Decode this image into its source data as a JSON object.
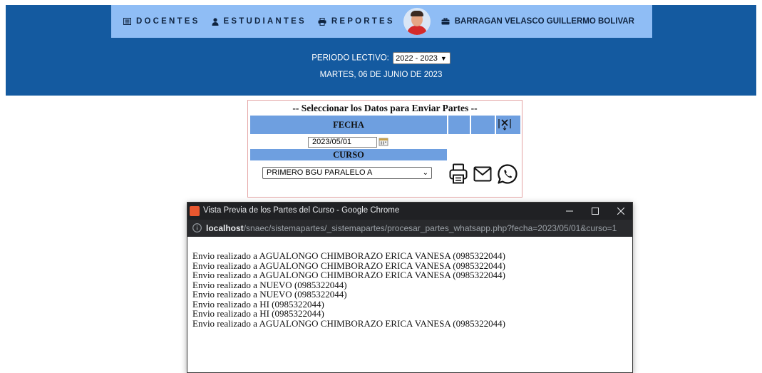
{
  "nav": {
    "docentes": "DOCENTES",
    "estudiantes": "ESTUDIANTES",
    "reportes": "REPORTES",
    "user_name": "BARRAGAN VELASCO GUILLERMO BOLIVAR"
  },
  "period": {
    "label": "PERIODO LECTIVO:",
    "selected": "2022 - 2023",
    "date_text": "MARTES, 06 DE JUNIO DE 2023"
  },
  "form": {
    "title": "-- Seleccionar los Datos para Enviar Partes --",
    "fecha_label": "FECHA",
    "fecha_value": "2023/05/01",
    "curso_label": "CURSO",
    "curso_selected": "PRIMERO BGU PARALELO A"
  },
  "popup": {
    "title": "Vista Previa de los Partes del Curso - Google Chrome",
    "url_host": "localhost",
    "url_path": "/snaec/sistemapartes/_sistemapartes/procesar_partes_whatsapp.php?fecha=2023/05/01&curso=1",
    "lines": [
      "Envio realizado a AGUALONGO CHIMBORAZO ERICA VANESA (0985322044)",
      "Envio realizado a AGUALONGO CHIMBORAZO ERICA VANESA (0985322044)",
      "Envio realizado a AGUALONGO CHIMBORAZO ERICA VANESA (0985322044)",
      "Envio realizado a NUEVO (0985322044)",
      "Envio realizado a NUEVO (0985322044)",
      "Envio realizado a HI (0985322044)",
      "Envio realizado a HI (0985322044)",
      "Envio realizado a AGUALONGO CHIMBORAZO ERICA VANESA (0985322044)"
    ]
  },
  "icons": {
    "docentes": "list-icon",
    "estudiantes": "user-icon",
    "reportes": "printer-icon",
    "user": "briefcase-icon",
    "export": "export-x-icon",
    "calendar": "calendar-icon",
    "print": "printer-icon",
    "mail": "envelope-icon",
    "whatsapp": "whatsapp-icon"
  },
  "colors": {
    "header_bg": "#145aa0",
    "nav_bg": "#8fbdf5",
    "table_header": "#6e9fe0",
    "form_border": "#e4a4a4",
    "popup_titlebar": "#202124"
  }
}
